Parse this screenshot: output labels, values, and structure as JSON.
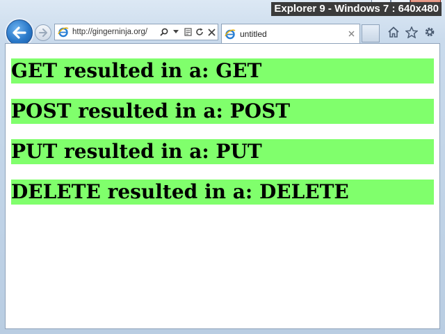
{
  "browser": {
    "overlay_label": "Explorer 9 - Windows 7 : 640x480",
    "address_url": "http://gingerninja.org/",
    "tab_title": "untitled"
  },
  "results": [
    {
      "text": "GET resulted in a: GET"
    },
    {
      "text": "POST resulted in a: POST"
    },
    {
      "text": "PUT resulted in a: PUT"
    },
    {
      "text": "DELETE resulted in a: DELETE"
    }
  ],
  "colors": {
    "result_background": "#80ff6c",
    "overlay_background": "#3b3b3b"
  },
  "icons": {
    "back": "back-arrow-icon",
    "forward": "forward-arrow-icon",
    "page": "ie-logo-icon",
    "search": "search-icon",
    "dropdown": "chevron-down-icon",
    "compat": "compatibility-view-icon",
    "refresh": "refresh-icon",
    "stop": "stop-icon",
    "tab_close": "close-icon",
    "home": "home-icon",
    "favorites": "star-icon",
    "tools": "gear-icon"
  }
}
